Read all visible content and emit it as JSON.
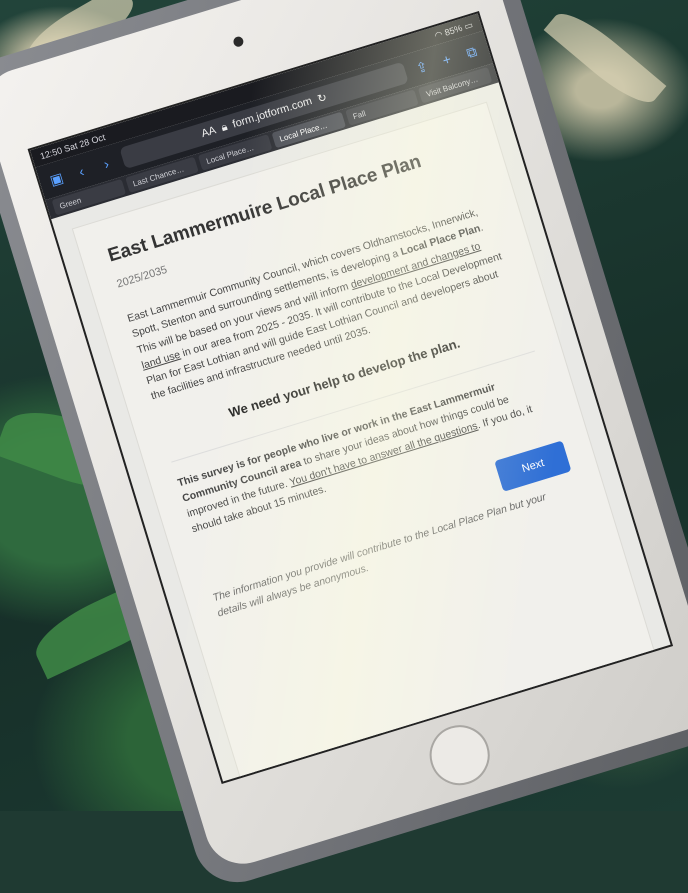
{
  "statusbar": {
    "time": "12:50",
    "date": "Sat 28 Oct",
    "battery": "85%"
  },
  "browser": {
    "aa_label": "AA",
    "url": "form.jotform.com",
    "tabs": [
      "Green",
      "Last Chance…",
      "Local Place…",
      "Local Place…",
      "Fall",
      "Visit Balcony…"
    ]
  },
  "form": {
    "title": "East Lammermuire Local Place Plan",
    "years": "2025/2035",
    "intro_1": "East Lammermuir Community Council, which covers Oldhamstocks, Innerwick, Spott, Stenton and surrounding settlements, is developing a ",
    "intro_bold": "Local Place Plan",
    "intro_2": ". This will be based on your views and will inform ",
    "intro_link": "development and changes to land use",
    "intro_3": " in our area from 2025 - 2035. It will contribute to the Local Development Plan for East Lothian and will guide East Lothian Council and developers about the facilities and infrastructure needed until 2035.",
    "heading": "We need your help to develop the plan.",
    "survey_bold": "This survey is for people who live or work in the East Lammermuir Community Council area",
    "survey_1": " to share your ideas about how things could be improved in the future. ",
    "survey_link": "You don't have to answer all the questions",
    "survey_2": ". If you do, it should take about 15 minutes.",
    "next_label": "Next",
    "footnote": "The information you provide will contribute to the Local Place Plan but your details will always be anonymous."
  },
  "colors": {
    "accent": "#2f6fd6",
    "fabric": "#1f3a32"
  }
}
